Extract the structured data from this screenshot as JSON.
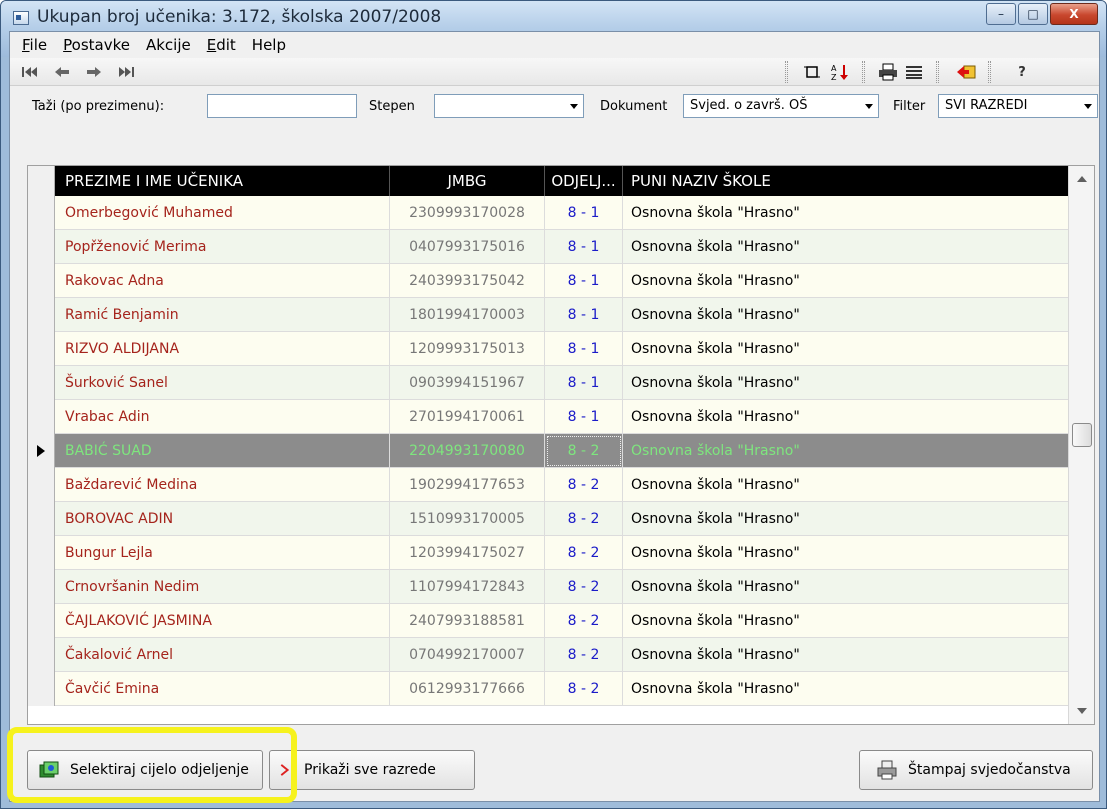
{
  "window": {
    "title": "Ukupan broj učenika: 3.172, školska 2007/2008",
    "controls": {
      "minimize": "–",
      "maximize": "□",
      "close": "X"
    }
  },
  "menu": {
    "items": [
      {
        "label": "File",
        "underline": "F",
        "rest": "ile"
      },
      {
        "label": "Postavke",
        "underline": "P",
        "rest": "ostavke"
      },
      {
        "label": "Akcije",
        "underline": "",
        "rest": "Akcije"
      },
      {
        "label": "Edit",
        "underline": "E",
        "rest": "dit"
      },
      {
        "label": "Help",
        "underline": "",
        "rest": "Help"
      }
    ]
  },
  "toolbar": {
    "nav": [
      "first-record-icon",
      "prev-record-icon",
      "next-record-icon",
      "last-record-icon"
    ],
    "right": [
      "crop-icon",
      "sort-icon",
      "print-icon",
      "list-icon",
      "export-icon",
      "help-icon"
    ],
    "help_glyph": "?"
  },
  "filters": {
    "search_label": "Taži (po prezimenu):",
    "search_value": "",
    "stepen_label": "Stepen",
    "stepen_value": "",
    "dokument_label": "Dokument",
    "dokument_value": "Svjed. o završ. OŠ",
    "filter_label": "Filter",
    "filter_value": "SVI RAZREDI"
  },
  "table": {
    "columns": [
      "PREZIME I IME UČENIKA",
      "JMBG",
      "ODJELJ...",
      "PUNI NAZIV ŠKOLE"
    ],
    "rows": [
      {
        "name": "Omerbegović Muhamed",
        "jmbg": "2309993170028",
        "odjel": "8 - 1",
        "skola": "Osnovna škola \"Hrasno\""
      },
      {
        "name": "Popřženović Merima",
        "jmbg": "0407993175016",
        "odjel": "8 - 1",
        "skola": "Osnovna škola \"Hrasno\""
      },
      {
        "name": "Rakovac Adna",
        "jmbg": "2403993175042",
        "odjel": "8 - 1",
        "skola": "Osnovna škola \"Hrasno\""
      },
      {
        "name": "Ramić Benjamin",
        "jmbg": "1801994170003",
        "odjel": "8 - 1",
        "skola": "Osnovna škola \"Hrasno\""
      },
      {
        "name": "RIZVO ALDIJANA",
        "jmbg": "1209993175013",
        "odjel": "8 - 1",
        "skola": "Osnovna škola \"Hrasno\""
      },
      {
        "name": "Šurković Sanel",
        "jmbg": "0903994151967",
        "odjel": "8 - 1",
        "skola": "Osnovna škola \"Hrasno\""
      },
      {
        "name": "Vrabac Adin",
        "jmbg": "2701994170061",
        "odjel": "8 - 1",
        "skola": "Osnovna škola \"Hrasno\""
      },
      {
        "name": "BABIĆ SUAD",
        "jmbg": "2204993170080",
        "odjel": "8 - 2",
        "skola": "Osnovna škola \"Hrasno\"",
        "selected": true
      },
      {
        "name": "Baždarević Medina",
        "jmbg": "1902994177653",
        "odjel": "8 - 2",
        "skola": "Osnovna škola \"Hrasno\""
      },
      {
        "name": "BOROVAC ADIN",
        "jmbg": "1510993170005",
        "odjel": "8 - 2",
        "skola": "Osnovna škola \"Hrasno\""
      },
      {
        "name": "Bungur Lejla",
        "jmbg": "1203994175027",
        "odjel": "8 - 2",
        "skola": "Osnovna škola \"Hrasno\""
      },
      {
        "name": "Crnovršanin Nedim",
        "jmbg": "1107994172843",
        "odjel": "8 - 2",
        "skola": "Osnovna škola \"Hrasno\""
      },
      {
        "name": "ČAJLAKOVIĆ  JASMINA",
        "jmbg": "2407993188581",
        "odjel": "8 - 2",
        "skola": "Osnovna škola \"Hrasno\""
      },
      {
        "name": "Čakalović Arnel",
        "jmbg": "0704992170007",
        "odjel": "8 - 2",
        "skola": "Osnovna škola \"Hrasno\""
      },
      {
        "name": "Čavčić Emina",
        "jmbg": "0612993177666",
        "odjel": "8 - 2",
        "skola": "Osnovna škola \"Hrasno\""
      }
    ]
  },
  "buttons": {
    "select_class": "Selektiraj cijelo odjeljenje",
    "show_all": "Prikaži sve razrede",
    "print_certs": "Štampaj svjedočanstva"
  },
  "colors": {
    "name_text": "#a5241c",
    "odjel_text": "#1b1bc8",
    "selected_row_bg": "#8c8c8c",
    "selected_row_text": "#7ee67e",
    "highlight": "#f6f21d"
  }
}
